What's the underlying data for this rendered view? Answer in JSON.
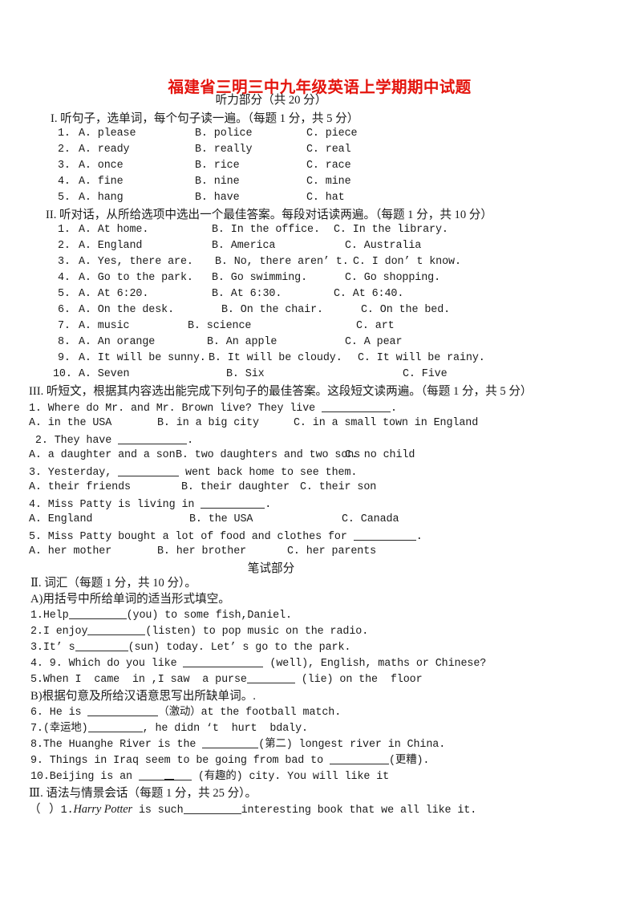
{
  "doc": {
    "title": "福建省三明三中九年级英语上学期期中试题",
    "title_color": "#e4140d",
    "listening_part_heading": "听力部分（共 20 分）",
    "written_part_heading": "笔试部分"
  },
  "listening": {
    "section1": {
      "heading": "I. 听句子，选单词，每个句子读一遍。（每题 1 分，共 5 分）",
      "items": [
        {
          "num": "1.",
          "a": "A. please",
          "b": "B. police",
          "c": "C. piece"
        },
        {
          "num": "2.",
          "a": "A. ready",
          "b": "B. really",
          "c": "C. real"
        },
        {
          "num": "3.",
          "a": "A. once",
          "b": "B. rice",
          "c": "C. race"
        },
        {
          "num": "4.",
          "a": "A. fine",
          "b": "B. nine",
          "c": "C. mine"
        },
        {
          "num": "5.",
          "a": "A. hang",
          "b": "B. have",
          "c": "C. hat"
        }
      ]
    },
    "section2": {
      "heading": "II. 听对话，从所给选项中选出一个最佳答案。每段对话读两遍。（每题 1 分，共 10 分）",
      "items": [
        {
          "num": "1.",
          "a": "A. At home.",
          "b": "B. In the office.",
          "c": "C. In the library."
        },
        {
          "num": "2.",
          "a": "A. England",
          "b": "B. America",
          "c": "C. Australia"
        },
        {
          "num": "3.",
          "a": "A. Yes, there are.",
          "b": "B. No, there aren’ t.",
          "c": "C. I don’ t know."
        },
        {
          "num": "4.",
          "a": "A. Go to the park.",
          "b": "B. Go swimming.",
          "c": "C. Go shopping."
        },
        {
          "num": "5.",
          "a": "A. At 6:20.",
          "b": "B. At 6:30.",
          "c": "C. At 6:40."
        },
        {
          "num": "6.",
          "a": "A. On the desk.",
          "b": "B. On the chair.",
          "c": "C. On the bed."
        },
        {
          "num": "7.",
          "a": "A. music",
          "b": "B. science",
          "c": "C. art"
        },
        {
          "num": "8.",
          "a": "A. An orange",
          "b": "B. An apple",
          "c": "C. A pear"
        },
        {
          "num": "9.",
          "a": "A. It will be sunny.",
          "b": "B. It will be cloudy.",
          "c": "C. It will be rainy."
        },
        {
          "num": "10.",
          "a": "A. Seven",
          "b": "B. Six",
          "c": "C. Five"
        }
      ]
    },
    "section3": {
      "heading": "III. 听短文，根据其内容选出能完成下列句子的最佳答案。这段短文读两遍。（每题 1 分，共 5 分）",
      "q1_stem_before": "1. Where do Mr. and Mr. Brown live? They live ",
      "q1_stem_after": ".",
      "q1_a": "A. in the USA",
      "q1_b": "B. in a big city",
      "q1_c": "C. in a small town in England",
      "q2_stem_before": " 2. They have ",
      "q2_stem_after": ".",
      "q2_a": "A. a daughter and a son",
      "q2_b": "B. two daughters and two sons",
      "q2_c": "C. no child",
      "q3_stem_before": "3. Yesterday, ",
      "q3_stem_after": " went back home to see them.",
      "q3_a": "A. their friends",
      "q3_b": "B. their daughter",
      "q3_c": "C. their son",
      "q4_stem_before": "4. Miss Patty is living in ",
      "q4_stem_after": ".",
      "q4_a": "A. England",
      "q4_b": "B. the USA",
      "q4_c": "C. Canada",
      "q5_stem_before": "5. Miss Patty bought a lot of food and clothes for ",
      "q5_stem_after": ".",
      "q5_a": "A. her mother",
      "q5_b": "B. her brother",
      "q5_c": "C. her parents"
    }
  },
  "written": {
    "vocab": {
      "heading": "Ⅱ. 词汇（每题 1 分，共 10 分）。",
      "sub_a": "A)用括号中所给单词的适当形式填空。",
      "a1_before": "1.Help",
      "a1_after": "(you) to some fish,Daniel.",
      "a2_before": "2.I enjoy",
      "a2_after": "(listen) to pop music on the radio.",
      "a3_before": "3.It’ s",
      "a3_after": "(sun) today. Let’ s go to the park.",
      "a4_before": "4. 9. Which do you like ",
      "a4_after": " (well), English, maths or Chinese?",
      "a5_before": "5.When I  came  in ,I saw  a purse",
      "a5_after": " (lie) on the  floor",
      "sub_b": "B)根据句意及所给汉语意思写出所缺单词。.",
      "b6_before": "6. He is ",
      "b6_after": "（激动）at the football match.",
      "b7_before": "7.(幸运地)",
      "b7_after": ", he didn ‘t  hurt  bdaly.",
      "b8_before": "8.The Huanghe River is the ",
      "b8_after": "(第二) longest river in China.",
      "b9_before": "9. Things in Iraq seem to be going from bad to ",
      "b9_after": "(更糟).",
      "b10_before": "10.Beijing is an ",
      "b10_after": " (有趣的) city. You will like it"
    },
    "grammar": {
      "heading": "Ⅲ. 语法与情景会话（每题 1 分，共 25 分）。",
      "q1_bracket": "（   ）",
      "q1_num": "1.",
      "q1_italic": "Harry Potter",
      "q1_before": " is such",
      "q1_after": "interesting book that we all like it."
    }
  }
}
